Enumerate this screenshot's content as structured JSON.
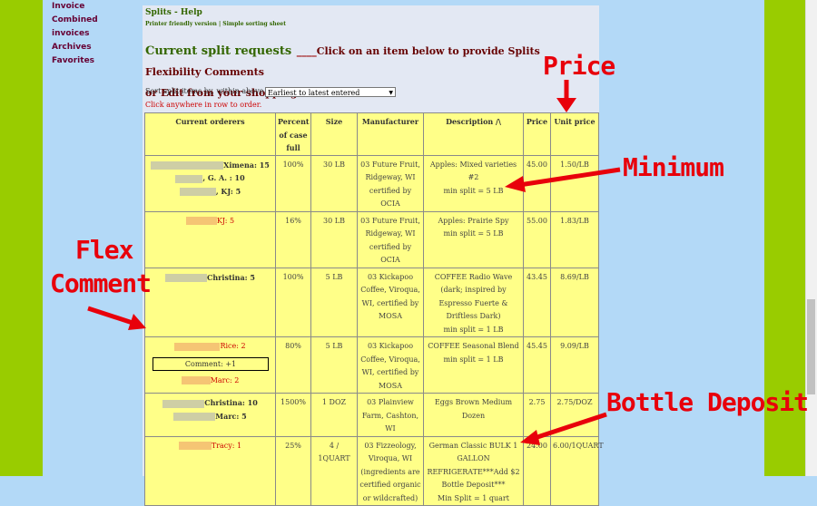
{
  "sidebar": {
    "items": [
      {
        "label": "Invoice"
      },
      {
        "label": "Combined invoices"
      },
      {
        "label": "Archives"
      },
      {
        "label": "Favorites"
      }
    ]
  },
  "panel": {
    "title": "Splits - Help",
    "links": {
      "printer": "Printer friendly version",
      "separator": " | ",
      "sorting": "Simple sorting sheet"
    }
  },
  "heading": {
    "title": "Current split requests",
    "blank": "____",
    "instruction": "Click on an item below to provide Splits Flexibility Comments",
    "line2": "or Edit from your shopping cart."
  },
  "sort": {
    "label": "Sort split items by, within above sort:",
    "selected": "Earliest to latest entered"
  },
  "click_hint": "Click anywhere in row to order.",
  "table": {
    "headers": [
      "Current orderers",
      "Percent of case full",
      "Size",
      "Manufacturer",
      "Description /\\",
      "Price",
      "Unit price"
    ],
    "rows": [
      {
        "orderers": [
          {
            "text": "Ximena: 15",
            "bold": true,
            "red": false
          },
          {
            "text": ", G. A. : 10",
            "bold": true,
            "red": false
          },
          {
            "text": ", KJ: 5",
            "bold": true,
            "red": false
          }
        ],
        "percent": "100%",
        "size": "30 LB",
        "manufacturer": "03 Future Fruit, Ridgeway, WI certified by OCIA",
        "description": "Apples: Mixed varieties #2",
        "min_split": "min split = 5 LB",
        "price": "45.00",
        "unit": "1.50/LB"
      },
      {
        "orderers": [
          {
            "text": "KJ: 5",
            "bold": false,
            "red": true
          }
        ],
        "percent": "16%",
        "size": "30 LB",
        "manufacturer": "03 Future Fruit, Ridgeway, WI certified by OCIA",
        "description": "Apples: Prairie Spy",
        "min_split": "min split = 5 LB",
        "price": "55.00",
        "unit": "1.83/LB"
      },
      {
        "orderers": [
          {
            "text": "Christina: 5",
            "bold": true,
            "red": false
          }
        ],
        "percent": "100%",
        "size": "5 LB",
        "manufacturer": "03 Kickapoo Coffee, Viroqua, WI, certified by MOSA",
        "description": "COFFEE Radio Wave (dark; inspired by Espresso Fuerte & Driftless Dark)",
        "min_split": "min split = 1 LB",
        "price": "43.45",
        "unit": "8.69/LB"
      },
      {
        "orderers": [
          {
            "text": "Rice: 2",
            "bold": false,
            "red": true
          },
          {
            "text": "Marc: 2",
            "bold": false,
            "red": true
          }
        ],
        "comment": "Comment: +1",
        "percent": "80%",
        "size": "5 LB",
        "manufacturer": "03 Kickapoo Coffee, Viroqua, WI, certified by MOSA",
        "description": "COFFEE Seasonal Blend",
        "min_split": "min split = 1 LB",
        "price": "45.45",
        "unit": "9.09/LB"
      },
      {
        "orderers": [
          {
            "text": "Christina: 10",
            "bold": true,
            "red": false
          },
          {
            "text": "Marc: 5",
            "bold": true,
            "red": false
          }
        ],
        "percent": "1500%",
        "size": "1 DOZ",
        "manufacturer": "03 Plainview Farm, Cashton, WI",
        "description": "Eggs Brown Medium Dozen",
        "min_split": "",
        "price": "2.75",
        "unit": "2.75/DOZ"
      },
      {
        "orderers": [
          {
            "text": "Tracy: 1",
            "bold": false,
            "red": true
          }
        ],
        "percent": "25%",
        "size": "4 / 1QUART",
        "manufacturer": "03 Fizzeology, Viroqua, WI (ingredients are certified organic or wildcrafted)",
        "description": "German Classic BULK 1 GALLON REFRIGERATE***Add $2 Bottle Deposit***",
        "min_split": "Min Split = 1 quart",
        "price": "24.00",
        "unit": "6.00/1QUART"
      }
    ]
  },
  "annotations": {
    "price": "Price",
    "minimum": "Minimum",
    "flex1": "Flex",
    "flex2": "Comment",
    "bottle": "Bottle Deposit",
    "color": "#e8000b"
  }
}
